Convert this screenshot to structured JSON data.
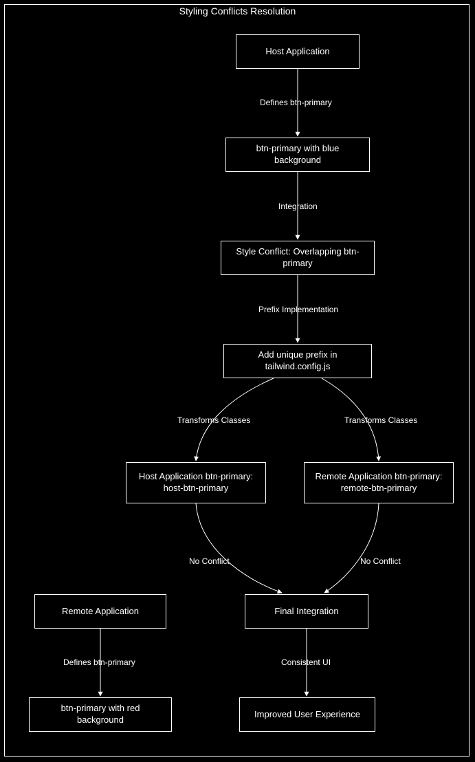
{
  "title": "Styling Conflicts Resolution",
  "nodes": {
    "n_host": "Host Application",
    "n_blue": "btn-primary with blue background",
    "n_conflict": "Style Conflict: Overlapping btn-primary",
    "n_prefix": "Add unique prefix in tailwind.config.js",
    "n_hostbtn": "Host Application btn-primary: host-btn-primary",
    "n_remotebtn": "Remote Application btn-primary: remote-btn-primary",
    "n_remote": "Remote Application",
    "n_final": "Final Integration",
    "n_red": "btn-primary with red background",
    "n_ux": "Improved User Experience"
  },
  "edges": {
    "e1": "Defines btn-primary",
    "e2": "Integration",
    "e3": "Prefix Implementation",
    "e4": "Transforms Classes",
    "e5": "Transforms Classes",
    "e6": "No Conflict",
    "e7": "No Conflict",
    "e8": "Defines btn-primary",
    "e9": "Consistent UI"
  }
}
